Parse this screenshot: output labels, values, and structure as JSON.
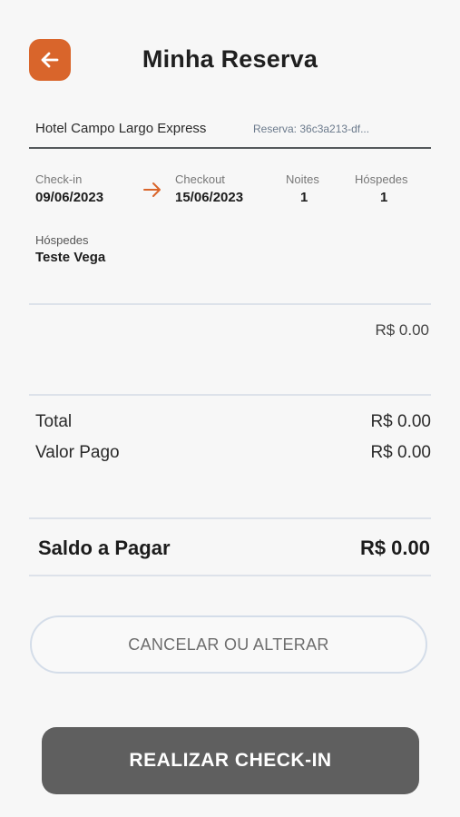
{
  "header": {
    "title": "Minha Reserva",
    "back_icon": "arrow-left-icon"
  },
  "hotel": {
    "name": "Hotel Campo Largo Express",
    "reservation_code": "Reserva: 36c3a213-df..."
  },
  "stay": {
    "checkin_label": "Check-in",
    "checkin_date": "09/06/2023",
    "arrow_icon": "arrow-right-icon",
    "checkout_label": "Checkout",
    "checkout_date": "15/06/2023",
    "nights_label": "Noites",
    "nights_value": "1",
    "guests_label": "Hóspedes",
    "guests_value": "1"
  },
  "guest_info": {
    "label": "Hóspedes",
    "name": "Teste Vega"
  },
  "items_amount": "R$ 0.00",
  "totals": {
    "total_label": "Total",
    "total_value": "R$ 0.00",
    "paid_label": "Valor Pago",
    "paid_value": "R$ 0.00"
  },
  "balance": {
    "label": "Saldo a Pagar",
    "value": "R$ 0.00"
  },
  "actions": {
    "cancel_label": "CANCELAR OU ALTERAR",
    "checkin_label": "REALIZAR CHECK-IN"
  },
  "colors": {
    "accent": "#d9652b",
    "primary_button": "#5f5f5f",
    "background": "#f7f7f7",
    "divider": "#dde2ea"
  }
}
